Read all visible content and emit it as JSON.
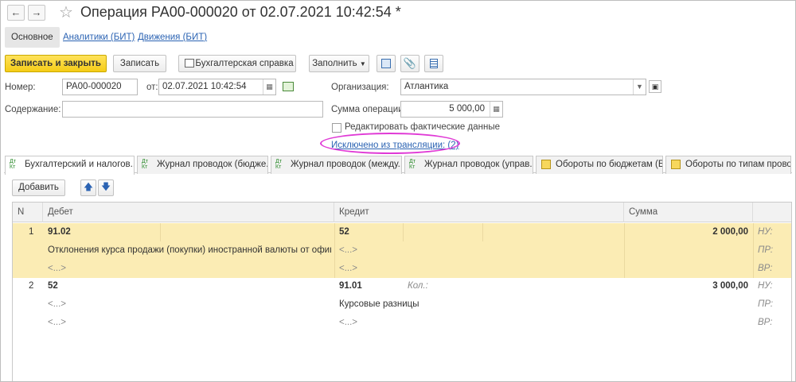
{
  "window": {
    "title": "Операция РА00-000020 от 02.07.2021 10:42:54 *"
  },
  "top_tabs": [
    {
      "label": "Основное"
    },
    {
      "label": "Аналитики (БИТ)"
    },
    {
      "label": "Движения (БИТ)"
    }
  ],
  "toolbar": {
    "save_close": "Записать и закрыть",
    "save": "Записать",
    "report": "Бухгалтерская справка",
    "fill": "Заполнить"
  },
  "form": {
    "number_label": "Номер:",
    "number_value": "РА00-000020",
    "date_label": "от:",
    "date_value": "02.07.2021 10:42:54",
    "org_label": "Организация:",
    "org_value": "Атлантика",
    "content_label": "Содержание:",
    "content_value": "",
    "sum_label": "Сумма операции:",
    "sum_value": "5 000,00",
    "edit_actual_label": "Редактировать фактические данные",
    "excluded_link": "Исключено из трансляции: (2)"
  },
  "doc_tabs": [
    {
      "label": "Бухгалтерский и налогов..."
    },
    {
      "label": "Журнал проводок (бюдже..."
    },
    {
      "label": "Журнал проводок (между..."
    },
    {
      "label": "Журнал проводок (управ..."
    },
    {
      "label": "Обороты по бюджетам (Б..."
    },
    {
      "label": "Обороты по типам прово..."
    }
  ],
  "table_toolbar": {
    "add": "Добавить"
  },
  "table": {
    "headers": {
      "n": "N",
      "debit": "Дебет",
      "credit": "Кредит",
      "sum": "Сумма"
    },
    "rows": [
      {
        "n": "1",
        "debit_account": "91.02",
        "credit_account": "52",
        "credit_extra": "",
        "sum": "2 000,00",
        "debit_sub1": "Отклонения курса продажи (покупки) иностранной валюты от официал...",
        "credit_sub1": "<...>",
        "debit_sub2": "<...>",
        "credit_sub2": "<...>",
        "tax1": "НУ:",
        "tax2": "ПР:",
        "tax3": "ВР:"
      },
      {
        "n": "2",
        "debit_account": "52",
        "credit_account": "91.01",
        "credit_extra": "Кол.:",
        "sum": "3 000,00",
        "debit_sub1": "<...>",
        "credit_sub1": "Курсовые разницы",
        "debit_sub2": "<...>",
        "credit_sub2": "<...>",
        "tax1": "НУ:",
        "tax2": "ПР:",
        "tax3": "ВР:"
      }
    ]
  },
  "colors": {
    "accent_yellow": "#f5cc17",
    "selected_row": "#fbecb4",
    "link": "#2b63b3",
    "highlight_ellipse": "#e03ad6"
  }
}
